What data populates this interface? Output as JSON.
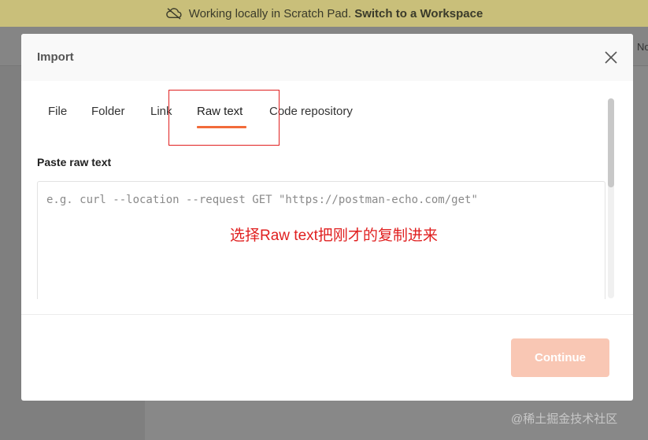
{
  "banner": {
    "icon": "cloud-offline-icon",
    "text": "Working locally in Scratch Pad.",
    "link": "Switch to a Workspace"
  },
  "background": {
    "peek_text": "No"
  },
  "modal": {
    "title": "Import",
    "close_icon": "close-icon",
    "tabs": [
      {
        "label": "File"
      },
      {
        "label": "Folder"
      },
      {
        "label": "Link"
      },
      {
        "label": "Raw text",
        "active": true
      },
      {
        "label": "Code repository"
      }
    ],
    "raw_text": {
      "label": "Paste raw text",
      "placeholder": "e.g. curl --location --request GET \"https://postman-echo.com/get\"",
      "value": ""
    },
    "annotation": "选择Raw text把刚才的复制进来",
    "continue_label": "Continue"
  },
  "watermark": "@稀土掘金技术社区",
  "colors": {
    "accent": "#f26b3a",
    "continue_disabled": "#f9c7b4",
    "annotation_red": "#e02020",
    "banner_bg": "#c9bf7a"
  }
}
